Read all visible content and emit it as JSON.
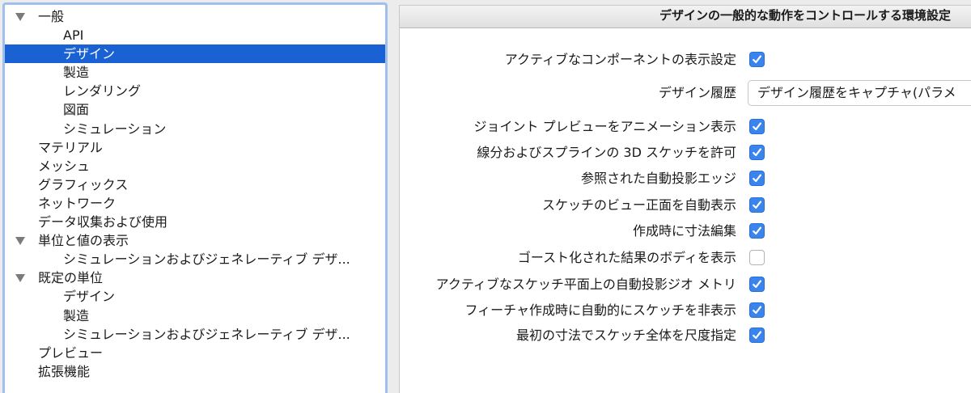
{
  "tree": {
    "items": [
      {
        "label": "一般",
        "level": 0,
        "expanded": true,
        "selected": false
      },
      {
        "label": "API",
        "level": 1,
        "expanded": false,
        "selected": false
      },
      {
        "label": "デザイン",
        "level": 1,
        "expanded": false,
        "selected": true
      },
      {
        "label": "製造",
        "level": 1,
        "expanded": false,
        "selected": false
      },
      {
        "label": "レンダリング",
        "level": 1,
        "expanded": false,
        "selected": false
      },
      {
        "label": "図面",
        "level": 1,
        "expanded": false,
        "selected": false
      },
      {
        "label": "シミュレーション",
        "level": 1,
        "expanded": false,
        "selected": false
      },
      {
        "label": "マテリアル",
        "level": 0,
        "expanded": false,
        "selected": false
      },
      {
        "label": "メッシュ",
        "level": 0,
        "expanded": false,
        "selected": false
      },
      {
        "label": "グラフィックス",
        "level": 0,
        "expanded": false,
        "selected": false
      },
      {
        "label": "ネットワーク",
        "level": 0,
        "expanded": false,
        "selected": false
      },
      {
        "label": "データ収集および使用",
        "level": 0,
        "expanded": false,
        "selected": false
      },
      {
        "label": "単位と値の表示",
        "level": 0,
        "expanded": true,
        "selected": false
      },
      {
        "label": "シミュレーションおよびジェネレーティブ デザ...",
        "level": 1,
        "expanded": false,
        "selected": false
      },
      {
        "label": "既定の単位",
        "level": 0,
        "expanded": true,
        "selected": false
      },
      {
        "label": "デザイン",
        "level": 1,
        "expanded": false,
        "selected": false
      },
      {
        "label": "製造",
        "level": 1,
        "expanded": false,
        "selected": false
      },
      {
        "label": "シミュレーションおよびジェネレーティブ デザ...",
        "level": 1,
        "expanded": false,
        "selected": false
      },
      {
        "label": "プレビュー",
        "level": 0,
        "expanded": false,
        "selected": false
      },
      {
        "label": "拡張機能",
        "level": 0,
        "expanded": false,
        "selected": false
      }
    ]
  },
  "panel": {
    "title": "デザインの一般的な動作をコントロールする環境設定",
    "settings": [
      {
        "label": "アクティブなコンポーネントの表示設定",
        "control": "checkbox",
        "checked": true
      },
      {
        "label": "デザイン履歴",
        "control": "select",
        "value": "デザイン履歴をキャプチャ(パラメ"
      },
      {
        "label": "ジョイント プレビューをアニメーション表示",
        "control": "checkbox",
        "checked": true
      },
      {
        "label": "線分およびスプラインの 3D スケッチを許可",
        "control": "checkbox",
        "checked": true
      },
      {
        "label": "参照された自動投影エッジ",
        "control": "checkbox",
        "checked": true
      },
      {
        "label": "スケッチのビュー正面を自動表示",
        "control": "checkbox",
        "checked": true
      },
      {
        "label": "作成時に寸法編集",
        "control": "checkbox",
        "checked": true
      },
      {
        "label": "ゴースト化された結果のボディを表示",
        "control": "checkbox",
        "checked": false
      },
      {
        "label": "アクティブなスケッチ平面上の自動投影ジオ メトリ",
        "control": "checkbox",
        "checked": true
      },
      {
        "label": "フィーチャ作成時に自動的にスケッチを非表示",
        "control": "checkbox",
        "checked": true
      },
      {
        "label": "最初の寸法でスケッチ全体を尺度指定",
        "control": "checkbox",
        "checked": true
      }
    ]
  },
  "colors": {
    "selection": "#1a61d4",
    "checkbox_on": "#3a84ee",
    "focus_ring": "#9fc0ec"
  }
}
